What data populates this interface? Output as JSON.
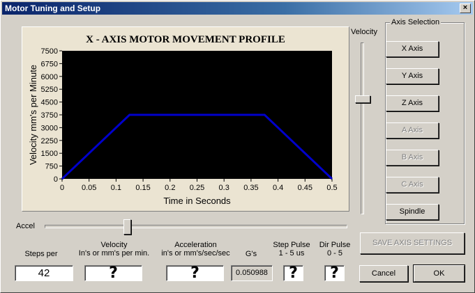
{
  "window": {
    "title": "Motor Tuning and Setup",
    "close_glyph": "×"
  },
  "chart_data": {
    "type": "line",
    "title": "X - AXIS MOTOR MOVEMENT PROFILE",
    "xlabel": "Time in Seconds",
    "ylabel": "Velocity mm's per Minute",
    "xlim": [
      0,
      0.5
    ],
    "ylim": [
      0,
      7500
    ],
    "x_ticks": [
      "0",
      "0.05",
      "0.1",
      "0.15",
      "0.2",
      "0.25",
      "0.3",
      "0.35",
      "0.4",
      "0.45",
      "0.5"
    ],
    "y_ticks": [
      "0",
      "750",
      "1500",
      "2250",
      "3000",
      "3750",
      "4500",
      "5250",
      "6000",
      "6750",
      "7500"
    ],
    "series": [
      {
        "x": [
          0,
          0.125,
          0.375,
          0.5
        ],
        "y": [
          0,
          3750,
          3750,
          0
        ],
        "color": "#0000cc"
      }
    ],
    "background": "#000000",
    "grid": false
  },
  "velocity_slider": {
    "label": "Velocity",
    "level": 0.67
  },
  "accel_slider": {
    "label": "Accel",
    "level": 0.27
  },
  "axis_selection": {
    "title": "Axis Selection",
    "buttons": [
      {
        "label": "X Axis",
        "enabled": true
      },
      {
        "label": "Y Axis",
        "enabled": true
      },
      {
        "label": "Z Axis",
        "enabled": true
      },
      {
        "label": "A Axis",
        "enabled": false
      },
      {
        "label": "B Axis",
        "enabled": false
      },
      {
        "label": "C Axis",
        "enabled": false
      },
      {
        "label": "Spindle",
        "enabled": true
      }
    ]
  },
  "save_button": "SAVE AXIS SETTINGS",
  "fields": {
    "steps_per": {
      "label": "Steps per",
      "value": "42"
    },
    "velocity": {
      "label_line1": "Velocity",
      "label_line2": "In's or mm's per min.",
      "value": "?"
    },
    "acceleration": {
      "label_line1": "Acceleration",
      "label_line2": "in's or mm's/sec/sec",
      "value": "?"
    },
    "gs": {
      "label": "G's",
      "value": "0.050988"
    },
    "step_pulse": {
      "label_line1": "Step Pulse",
      "label_line2": "1 - 5 us",
      "value": "?"
    },
    "dir_pulse": {
      "label_line1": "Dir Pulse",
      "label_line2": "0 - 5",
      "value": "?"
    }
  },
  "footer": {
    "cancel": "Cancel",
    "ok": "OK"
  }
}
